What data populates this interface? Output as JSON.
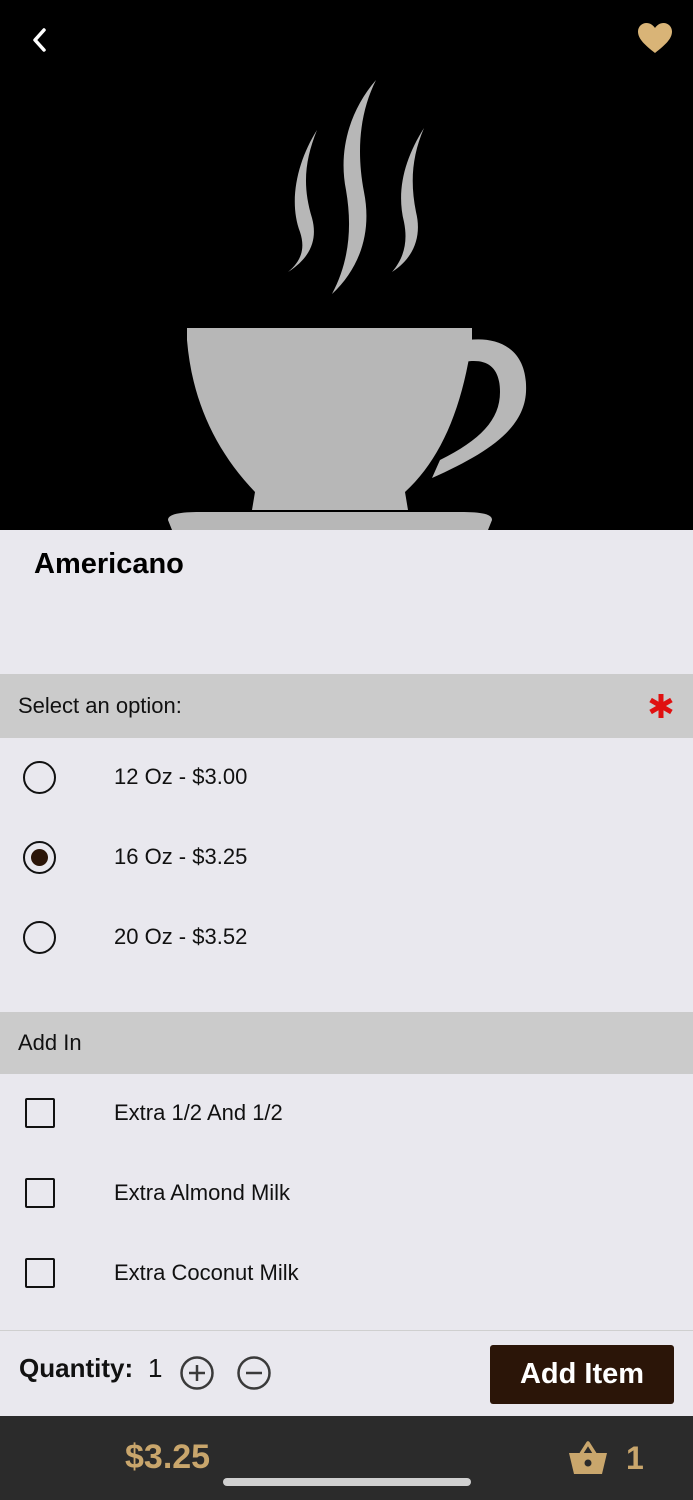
{
  "header": {
    "back_icon": "chevron-left-icon",
    "favorite_icon": "heart-icon",
    "favorite_color": "#d9b477"
  },
  "product": {
    "name": "Americano",
    "image": "coffee-cup-icon"
  },
  "size_section": {
    "label": "Select an option:",
    "required_icon": "asterisk-icon",
    "required_color": "#e01010",
    "options": [
      {
        "label": "12 Oz - $3.00",
        "selected": false
      },
      {
        "label": "16 Oz - $3.25",
        "selected": true
      },
      {
        "label": "20 Oz - $3.52",
        "selected": false
      }
    ]
  },
  "addin_section": {
    "label": "Add In",
    "options": [
      {
        "label": "Extra 1/2 And 1/2",
        "checked": false
      },
      {
        "label": "Extra Almond Milk",
        "checked": false
      },
      {
        "label": "Extra Coconut Milk",
        "checked": false
      }
    ]
  },
  "quantity": {
    "label": "Quantity:",
    "value": "1",
    "increase_icon": "plus-circle-icon",
    "decrease_icon": "minus-circle-icon"
  },
  "add_item": {
    "label": "Add Item",
    "color": "#2b1508"
  },
  "footer": {
    "price": "$3.25",
    "cart_icon": "basket-icon",
    "cart_count": "1",
    "accent_color": "#c9a66c"
  }
}
